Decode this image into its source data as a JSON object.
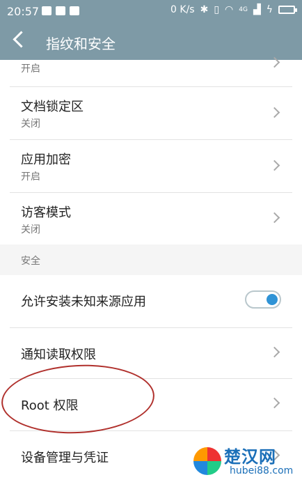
{
  "status_bar": {
    "time": "20:57",
    "net_speed": "0 K/s",
    "signal_label": "4G",
    "icons": [
      "message-icon",
      "image-icon",
      "notification-icon",
      "bluetooth-icon",
      "vibrate-icon",
      "wifi-icon",
      "signal-icon",
      "charging-icon",
      "battery-icon"
    ]
  },
  "header": {
    "title": "指纹和安全",
    "back_icon": "chevron-left-icon"
  },
  "list": {
    "partial_item": {
      "sub": "开启"
    },
    "items": [
      {
        "label": "文档锁定区",
        "sub": "关闭"
      },
      {
        "label": "应用加密",
        "sub": "开启"
      },
      {
        "label": "访客模式",
        "sub": "关闭"
      }
    ],
    "section_title": "安全",
    "security_items": [
      {
        "label": "允许安装未知来源应用",
        "toggle": true
      },
      {
        "label": "通知读取权限"
      },
      {
        "label": "Root 权限"
      },
      {
        "label": "设备管理与凭证"
      }
    ]
  },
  "watermark": {
    "brand": "楚汉网",
    "domain": "hubei88.com"
  },
  "colors": {
    "header_bg": "#7e9aa6",
    "toggle_knob": "#2f93d6",
    "annotation_circle": "#b0302c"
  }
}
